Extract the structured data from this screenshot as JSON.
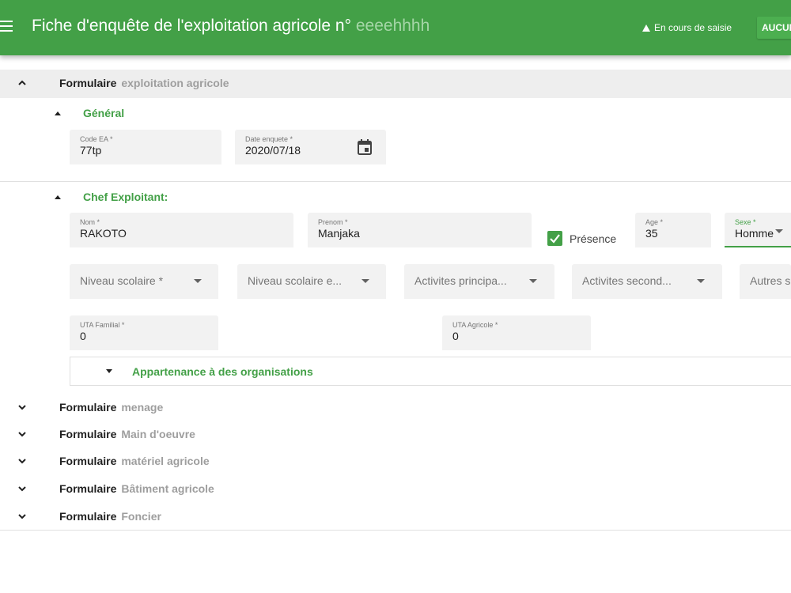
{
  "header": {
    "title": "Fiche d'enquête de l'exploitation agricole n°",
    "number": "eeeehhhh",
    "status": "En cours de saisie",
    "action_label": "AUCUN"
  },
  "sections": {
    "exploitation": {
      "label": "Formulaire",
      "sub": "exploitation agricole"
    },
    "menage": {
      "label": "Formulaire",
      "sub": "menage"
    },
    "main_oeuvre": {
      "label": "Formulaire",
      "sub": "Main d'oeuvre"
    },
    "materiel": {
      "label": "Formulaire",
      "sub": "matériel agricole"
    },
    "batiment": {
      "label": "Formulaire",
      "sub": "Bâtiment agricole"
    },
    "foncier": {
      "label": "Formulaire",
      "sub": "Foncier"
    }
  },
  "general": {
    "title": "Général",
    "code_ea": {
      "label": "Code EA *",
      "value": "77tp"
    },
    "date_enquete": {
      "label": "Date enquete *",
      "value": "2020/07/18"
    }
  },
  "chef": {
    "title": "Chef Exploitant:",
    "nom": {
      "label": "Nom *",
      "value": "RAKOTO"
    },
    "prenom": {
      "label": "Prenom *",
      "value": "Manjaka"
    },
    "presence": {
      "label": "Présence",
      "checked": true
    },
    "age": {
      "label": "Age *",
      "value": "35"
    },
    "sexe": {
      "label": "Sexe *",
      "value": "Homme"
    },
    "niveau_scolaire": "Niveau scolaire *",
    "niveau_scolaire_e": "Niveau scolaire e...",
    "activites_principales": "Activites principa...",
    "activites_secondaires": "Activites second...",
    "autres": "Autres s",
    "uta_familial": {
      "label": "UTA Familial *",
      "value": "0"
    },
    "uta_agricole": {
      "label": "UTA Agricole *",
      "value": "0"
    },
    "organisations": "Appartenance à des organisations"
  },
  "colors": {
    "primary": "#43a047",
    "field_bg": "#f2f2f2",
    "muted": "#9e9e9e"
  }
}
